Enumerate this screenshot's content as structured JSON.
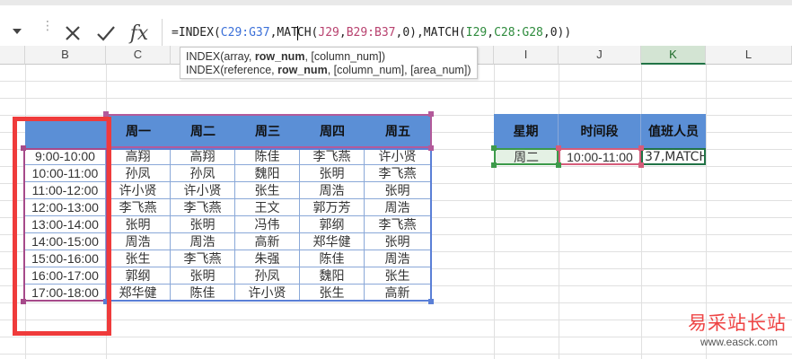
{
  "formula_bar": {
    "part_index": "=INDEX(",
    "ref1": "C29:G37",
    "part_match1": ",MAT",
    "part_match1b": "CH(",
    "ref2": "J29",
    "part_comma": ",",
    "ref3": "B29:B37",
    "part_zero1": ",0),MATCH(",
    "ref4": "I29",
    "part_comma2": ",",
    "ref5": "C28:G28",
    "part_end": ",0))"
  },
  "tooltip": {
    "line1_a": "INDEX(array, ",
    "line1_b": "row_num",
    "line1_c": ", [column_num])",
    "line2_a": "INDEX(reference, ",
    "line2_b": "row_num",
    "line2_c": ", [column_num], [area_num])"
  },
  "columns": [
    "B",
    "C",
    "I",
    "J",
    "K",
    "L"
  ],
  "schedule": {
    "days": [
      "周一",
      "周二",
      "周三",
      "周四",
      "周五"
    ],
    "times": [
      "9:00-10:00",
      "10:00-11:00",
      "11:00-12:00",
      "12:00-13:00",
      "13:00-14:00",
      "14:00-15:00",
      "15:00-16:00",
      "16:00-17:00",
      "17:00-18:00"
    ],
    "rows": [
      [
        "高翔",
        "高翔",
        "陈佳",
        "李飞燕",
        "许小贤"
      ],
      [
        "孙凤",
        "孙凤",
        "魏阳",
        "张明",
        "李飞燕"
      ],
      [
        "许小贤",
        "许小贤",
        "张生",
        "周浩",
        "张明"
      ],
      [
        "李飞燕",
        "李飞燕",
        "王文",
        "郭万芳",
        "周浩"
      ],
      [
        "张明",
        "张明",
        "冯伟",
        "郭纲",
        "李飞燕"
      ],
      [
        "周浩",
        "周浩",
        "高新",
        "郑华健",
        "张明"
      ],
      [
        "张生",
        "李飞燕",
        "朱强",
        "陈佳",
        "周浩"
      ],
      [
        "郭纲",
        "张明",
        "孙凤",
        "魏阳",
        "张生"
      ],
      [
        "郑华健",
        "陈佳",
        "许小贤",
        "张生",
        "高新"
      ]
    ]
  },
  "lookup": {
    "headers": [
      "星期",
      "时间段",
      "值班人员"
    ],
    "day": "周二",
    "time": "10:00-11:00",
    "result": "37,MATCH"
  },
  "watermark": {
    "cn": "易采站长站",
    "url": "www.easck.com"
  },
  "colors": {
    "header_blue": "#5b8fd6",
    "excel_green": "#217346",
    "annotation_red": "#ef3b3b"
  }
}
